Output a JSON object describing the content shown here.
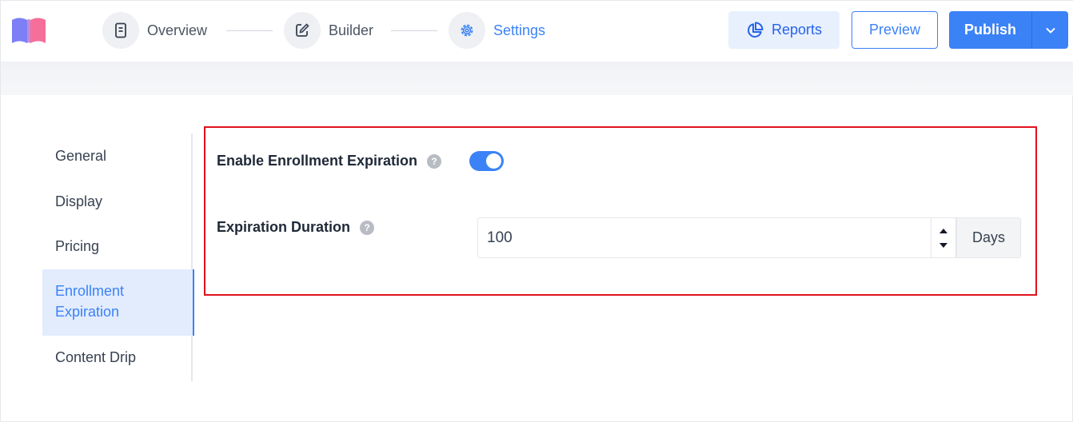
{
  "header": {
    "steps": [
      {
        "label": "Overview",
        "icon": "document-icon",
        "active": false
      },
      {
        "label": "Builder",
        "icon": "edit-icon",
        "active": false
      },
      {
        "label": "Settings",
        "icon": "gear-icon",
        "active": true
      }
    ],
    "reports_label": "Reports",
    "preview_label": "Preview",
    "publish_label": "Publish"
  },
  "sidebar": {
    "items": [
      {
        "label": "General"
      },
      {
        "label": "Display"
      },
      {
        "label": "Pricing"
      },
      {
        "label": "Enrollment Expiration",
        "active": true
      },
      {
        "label": "Content Drip"
      }
    ]
  },
  "settings": {
    "enable_expiration_label": "Enable Enrollment Expiration",
    "enable_expiration_on": true,
    "duration_label": "Expiration Duration",
    "duration_value": "100",
    "duration_unit": "Days",
    "help_glyph": "?"
  },
  "colors": {
    "accent": "#3b82f6",
    "highlight_border": "#e0121c"
  }
}
